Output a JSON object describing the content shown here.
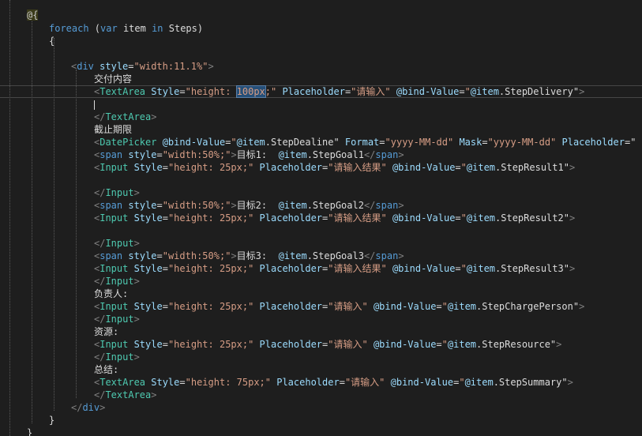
{
  "editor": {
    "lines": [
      {
        "tokens": [
          {
            "t": "@{",
            "c": "t-razor"
          }
        ]
      },
      {
        "tokens": [
          {
            "t": "foreach",
            "c": "t-kw"
          },
          {
            "t": " (",
            "c": "t-text"
          },
          {
            "t": "var",
            "c": "t-kw"
          },
          {
            "t": " item ",
            "c": "t-text"
          },
          {
            "t": "in",
            "c": "t-kw"
          },
          {
            "t": " Steps)",
            "c": "t-text"
          }
        ]
      },
      {
        "tokens": [
          {
            "t": "{",
            "c": "t-text"
          }
        ]
      },
      {
        "tokens": []
      },
      {
        "tokens": [
          {
            "t": "<",
            "c": "t-delim"
          },
          {
            "t": "div",
            "c": "t-tag"
          },
          {
            "t": " style",
            "c": "t-attr"
          },
          {
            "t": "=",
            "c": "t-text"
          },
          {
            "t": "\"width:11.1%\"",
            "c": "t-str"
          },
          {
            "t": ">",
            "c": "t-delim"
          }
        ]
      },
      {
        "tokens": [
          {
            "t": "交付内容",
            "c": "t-text"
          }
        ]
      },
      {
        "tokens": [
          {
            "t": "<",
            "c": "t-delim"
          },
          {
            "t": "TextArea",
            "c": "t-comp"
          },
          {
            "t": " Style",
            "c": "t-cattr"
          },
          {
            "t": "=",
            "c": "t-text"
          },
          {
            "t": "\"height: ",
            "c": "t-str"
          },
          {
            "t": "100px",
            "c": "t-sel"
          },
          {
            "t": ";\"",
            "c": "t-str"
          },
          {
            "t": " Placeholder",
            "c": "t-cattr"
          },
          {
            "t": "=",
            "c": "t-text"
          },
          {
            "t": "\"请输入\"",
            "c": "t-str"
          },
          {
            "t": " @bind-Value",
            "c": "t-attr"
          },
          {
            "t": "=",
            "c": "t-text"
          },
          {
            "t": "\"",
            "c": "t-str"
          },
          {
            "t": "@item",
            "c": "t-attr"
          },
          {
            "t": ".StepDelivery\"",
            "c": "t-text"
          },
          {
            "t": ">",
            "c": "t-delim"
          }
        ]
      },
      {
        "tokens": []
      },
      {
        "tokens": [
          {
            "t": "</",
            "c": "t-delim"
          },
          {
            "t": "TextArea",
            "c": "t-comp"
          },
          {
            "t": ">",
            "c": "t-delim"
          }
        ]
      },
      {
        "tokens": [
          {
            "t": "截止期限",
            "c": "t-text"
          }
        ]
      },
      {
        "tokens": [
          {
            "t": "<",
            "c": "t-delim"
          },
          {
            "t": "DatePicker",
            "c": "t-comp"
          },
          {
            "t": " @bind-Value",
            "c": "t-attr"
          },
          {
            "t": "=",
            "c": "t-text"
          },
          {
            "t": "\"",
            "c": "t-str"
          },
          {
            "t": "@item",
            "c": "t-attr"
          },
          {
            "t": ".StepDealine\"",
            "c": "t-text"
          },
          {
            "t": " Format",
            "c": "t-cattr"
          },
          {
            "t": "=",
            "c": "t-text"
          },
          {
            "t": "\"yyyy-MM-dd\"",
            "c": "t-str"
          },
          {
            "t": " Mask",
            "c": "t-cattr"
          },
          {
            "t": "=",
            "c": "t-text"
          },
          {
            "t": "\"yyyy-MM-dd\"",
            "c": "t-str"
          },
          {
            "t": " Placeholder",
            "c": "t-cattr"
          },
          {
            "t": "=\"",
            "c": "t-text"
          }
        ]
      },
      {
        "tokens": [
          {
            "t": "<",
            "c": "t-delim"
          },
          {
            "t": "span",
            "c": "t-tag"
          },
          {
            "t": " style",
            "c": "t-attr"
          },
          {
            "t": "=",
            "c": "t-text"
          },
          {
            "t": "\"width:50%;\"",
            "c": "t-str"
          },
          {
            "t": ">",
            "c": "t-delim"
          },
          {
            "t": "目标1:  ",
            "c": "t-text"
          },
          {
            "t": "@item",
            "c": "t-attr"
          },
          {
            "t": ".StepGoal1",
            "c": "t-text"
          },
          {
            "t": "</",
            "c": "t-delim"
          },
          {
            "t": "span",
            "c": "t-tag"
          },
          {
            "t": ">",
            "c": "t-delim"
          }
        ]
      },
      {
        "tokens": [
          {
            "t": "<",
            "c": "t-delim"
          },
          {
            "t": "Input",
            "c": "t-comp"
          },
          {
            "t": " Style",
            "c": "t-cattr"
          },
          {
            "t": "=",
            "c": "t-text"
          },
          {
            "t": "\"height: 25px;\"",
            "c": "t-str"
          },
          {
            "t": " Placeholder",
            "c": "t-cattr"
          },
          {
            "t": "=",
            "c": "t-text"
          },
          {
            "t": "\"请输入结果\"",
            "c": "t-str"
          },
          {
            "t": " @bind-Value",
            "c": "t-attr"
          },
          {
            "t": "=",
            "c": "t-text"
          },
          {
            "t": "\"",
            "c": "t-str"
          },
          {
            "t": "@item",
            "c": "t-attr"
          },
          {
            "t": ".StepResult1\"",
            "c": "t-text"
          },
          {
            "t": ">",
            "c": "t-delim"
          }
        ]
      },
      {
        "tokens": []
      },
      {
        "tokens": [
          {
            "t": "</",
            "c": "t-delim"
          },
          {
            "t": "Input",
            "c": "t-comp"
          },
          {
            "t": ">",
            "c": "t-delim"
          }
        ]
      },
      {
        "tokens": [
          {
            "t": "<",
            "c": "t-delim"
          },
          {
            "t": "span",
            "c": "t-tag"
          },
          {
            "t": " style",
            "c": "t-attr"
          },
          {
            "t": "=",
            "c": "t-text"
          },
          {
            "t": "\"width:50%;\"",
            "c": "t-str"
          },
          {
            "t": ">",
            "c": "t-delim"
          },
          {
            "t": "目标2:  ",
            "c": "t-text"
          },
          {
            "t": "@item",
            "c": "t-attr"
          },
          {
            "t": ".StepGoal2",
            "c": "t-text"
          },
          {
            "t": "</",
            "c": "t-delim"
          },
          {
            "t": "span",
            "c": "t-tag"
          },
          {
            "t": ">",
            "c": "t-delim"
          }
        ]
      },
      {
        "tokens": [
          {
            "t": "<",
            "c": "t-delim"
          },
          {
            "t": "Input",
            "c": "t-comp"
          },
          {
            "t": " Style",
            "c": "t-cattr"
          },
          {
            "t": "=",
            "c": "t-text"
          },
          {
            "t": "\"height: 25px;\"",
            "c": "t-str"
          },
          {
            "t": " Placeholder",
            "c": "t-cattr"
          },
          {
            "t": "=",
            "c": "t-text"
          },
          {
            "t": "\"请输入结果\"",
            "c": "t-str"
          },
          {
            "t": " @bind-Value",
            "c": "t-attr"
          },
          {
            "t": "=",
            "c": "t-text"
          },
          {
            "t": "\"",
            "c": "t-str"
          },
          {
            "t": "@item",
            "c": "t-attr"
          },
          {
            "t": ".StepResult2\"",
            "c": "t-text"
          },
          {
            "t": ">",
            "c": "t-delim"
          }
        ]
      },
      {
        "tokens": []
      },
      {
        "tokens": [
          {
            "t": "</",
            "c": "t-delim"
          },
          {
            "t": "Input",
            "c": "t-comp"
          },
          {
            "t": ">",
            "c": "t-delim"
          }
        ]
      },
      {
        "tokens": [
          {
            "t": "<",
            "c": "t-delim"
          },
          {
            "t": "span",
            "c": "t-tag"
          },
          {
            "t": " style",
            "c": "t-attr"
          },
          {
            "t": "=",
            "c": "t-text"
          },
          {
            "t": "\"width:50%;\"",
            "c": "t-str"
          },
          {
            "t": ">",
            "c": "t-delim"
          },
          {
            "t": "目标3:  ",
            "c": "t-text"
          },
          {
            "t": "@item",
            "c": "t-attr"
          },
          {
            "t": ".StepGoal3",
            "c": "t-text"
          },
          {
            "t": "</",
            "c": "t-delim"
          },
          {
            "t": "span",
            "c": "t-tag"
          },
          {
            "t": ">",
            "c": "t-delim"
          }
        ]
      },
      {
        "tokens": [
          {
            "t": "<",
            "c": "t-delim"
          },
          {
            "t": "Input",
            "c": "t-comp"
          },
          {
            "t": " Style",
            "c": "t-cattr"
          },
          {
            "t": "=",
            "c": "t-text"
          },
          {
            "t": "\"height: 25px;\"",
            "c": "t-str"
          },
          {
            "t": " Placeholder",
            "c": "t-cattr"
          },
          {
            "t": "=",
            "c": "t-text"
          },
          {
            "t": "\"请输入结果\"",
            "c": "t-str"
          },
          {
            "t": " @bind-Value",
            "c": "t-attr"
          },
          {
            "t": "=",
            "c": "t-text"
          },
          {
            "t": "\"",
            "c": "t-str"
          },
          {
            "t": "@item",
            "c": "t-attr"
          },
          {
            "t": ".StepResult3\"",
            "c": "t-text"
          },
          {
            "t": ">",
            "c": "t-delim"
          }
        ]
      },
      {
        "tokens": [
          {
            "t": "</",
            "c": "t-delim"
          },
          {
            "t": "Input",
            "c": "t-comp"
          },
          {
            "t": ">",
            "c": "t-delim"
          }
        ]
      },
      {
        "tokens": [
          {
            "t": "负责人:",
            "c": "t-text"
          }
        ]
      },
      {
        "tokens": [
          {
            "t": "<",
            "c": "t-delim"
          },
          {
            "t": "Input",
            "c": "t-comp"
          },
          {
            "t": " Style",
            "c": "t-cattr"
          },
          {
            "t": "=",
            "c": "t-text"
          },
          {
            "t": "\"height: 25px;\"",
            "c": "t-str"
          },
          {
            "t": " Placeholder",
            "c": "t-cattr"
          },
          {
            "t": "=",
            "c": "t-text"
          },
          {
            "t": "\"请输入\"",
            "c": "t-str"
          },
          {
            "t": " @bind-Value",
            "c": "t-attr"
          },
          {
            "t": "=",
            "c": "t-text"
          },
          {
            "t": "\"",
            "c": "t-str"
          },
          {
            "t": "@item",
            "c": "t-attr"
          },
          {
            "t": ".StepChargePerson\"",
            "c": "t-text"
          },
          {
            "t": ">",
            "c": "t-delim"
          }
        ]
      },
      {
        "tokens": [
          {
            "t": "</",
            "c": "t-delim"
          },
          {
            "t": "Input",
            "c": "t-comp"
          },
          {
            "t": ">",
            "c": "t-delim"
          }
        ]
      },
      {
        "tokens": [
          {
            "t": "资源:",
            "c": "t-text"
          }
        ]
      },
      {
        "tokens": [
          {
            "t": "<",
            "c": "t-delim"
          },
          {
            "t": "Input",
            "c": "t-comp"
          },
          {
            "t": " Style",
            "c": "t-cattr"
          },
          {
            "t": "=",
            "c": "t-text"
          },
          {
            "t": "\"height: 25px;\"",
            "c": "t-str"
          },
          {
            "t": " Placeholder",
            "c": "t-cattr"
          },
          {
            "t": "=",
            "c": "t-text"
          },
          {
            "t": "\"请输入\"",
            "c": "t-str"
          },
          {
            "t": " @bind-Value",
            "c": "t-attr"
          },
          {
            "t": "=",
            "c": "t-text"
          },
          {
            "t": "\"",
            "c": "t-str"
          },
          {
            "t": "@item",
            "c": "t-attr"
          },
          {
            "t": ".StepResource\"",
            "c": "t-text"
          },
          {
            "t": ">",
            "c": "t-delim"
          }
        ]
      },
      {
        "tokens": [
          {
            "t": "</",
            "c": "t-delim"
          },
          {
            "t": "Input",
            "c": "t-comp"
          },
          {
            "t": ">",
            "c": "t-delim"
          }
        ]
      },
      {
        "tokens": [
          {
            "t": "总结:",
            "c": "t-text"
          }
        ]
      },
      {
        "tokens": [
          {
            "t": "<",
            "c": "t-delim"
          },
          {
            "t": "TextArea",
            "c": "t-comp"
          },
          {
            "t": " Style",
            "c": "t-cattr"
          },
          {
            "t": "=",
            "c": "t-text"
          },
          {
            "t": "\"height: 75px;\"",
            "c": "t-str"
          },
          {
            "t": " Placeholder",
            "c": "t-cattr"
          },
          {
            "t": "=",
            "c": "t-text"
          },
          {
            "t": "\"请输入\"",
            "c": "t-str"
          },
          {
            "t": " @bind-Value",
            "c": "t-attr"
          },
          {
            "t": "=",
            "c": "t-text"
          },
          {
            "t": "\"",
            "c": "t-str"
          },
          {
            "t": "@item",
            "c": "t-attr"
          },
          {
            "t": ".StepSummary\"",
            "c": "t-text"
          },
          {
            "t": ">",
            "c": "t-delim"
          }
        ]
      },
      {
        "tokens": [
          {
            "t": "</",
            "c": "t-delim"
          },
          {
            "t": "TextArea",
            "c": "t-comp"
          },
          {
            "t": ">",
            "c": "t-delim"
          }
        ]
      },
      {
        "tokens": [
          {
            "t": "</",
            "c": "t-delim"
          },
          {
            "t": "div",
            "c": "t-tag"
          },
          {
            "t": ">",
            "c": "t-delim"
          }
        ]
      },
      {
        "tokens": [
          {
            "t": "}",
            "c": "t-text"
          }
        ]
      },
      {
        "tokens": [
          {
            "t": "}",
            "c": "t-text"
          }
        ]
      }
    ]
  }
}
